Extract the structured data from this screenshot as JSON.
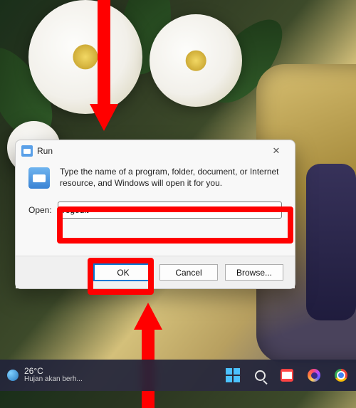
{
  "run": {
    "title": "Run",
    "description": "Type the name of a program, folder, document, or Internet resource, and Windows will open it for you.",
    "open_label": "Open:",
    "input_value": "regedit",
    "ok_label": "OK",
    "cancel_label": "Cancel",
    "browse_label": "Browse..."
  },
  "taskbar": {
    "temperature": "26°C",
    "condition": "Hujan akan berh..."
  }
}
